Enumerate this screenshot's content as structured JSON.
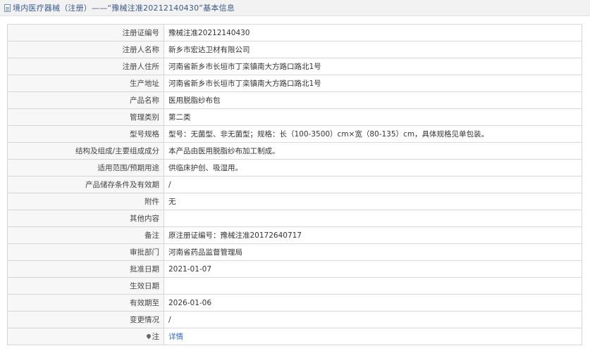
{
  "header": {
    "title": "境内医疗器械（注册）——“豫械注准20212140430”基本信息"
  },
  "rows": [
    {
      "label": "注册证编号",
      "value": "豫械注准20212140430"
    },
    {
      "label": "注册人名称",
      "value": "新乡市宏达卫材有限公司"
    },
    {
      "label": "注册人住所",
      "value": "河南省新乡市长垣市丁栾镇南大方路口路北1号"
    },
    {
      "label": "生产地址",
      "value": "河南省新乡市长垣市丁栾镇南大方路口路北1号"
    },
    {
      "label": "产品名称",
      "value": "医用脱脂纱布包"
    },
    {
      "label": "管理类别",
      "value": "第二类"
    },
    {
      "label": "型号规格",
      "value": "型号：无菌型、非无菌型；规格：长（100-3500）cm×宽（80-135）cm，具体规格见单包装。"
    },
    {
      "label": "结构及组成/主要组成成分",
      "value": "本产品由医用脱脂纱布加工制成。"
    },
    {
      "label": "适用范围/预期用途",
      "value": "供临床护创、吸湿用。"
    },
    {
      "label": "产品储存条件及有效期",
      "value": "/"
    },
    {
      "label": "附件",
      "value": "无"
    },
    {
      "label": "其他内容",
      "value": ""
    },
    {
      "label": "备注",
      "value": "原注册证编号：豫械注准20172640717"
    },
    {
      "label": "审批部门",
      "value": "河南省药品监督管理局"
    },
    {
      "label": "批准日期",
      "value": "2021-01-07"
    },
    {
      "label": "生效日期",
      "value": ""
    },
    {
      "label": "有效期至",
      "value": "2026-01-06"
    },
    {
      "label": "变更情况",
      "value": "/"
    }
  ],
  "note_row": {
    "label": "注",
    "icon": "pin-icon",
    "link_text": "详情"
  }
}
